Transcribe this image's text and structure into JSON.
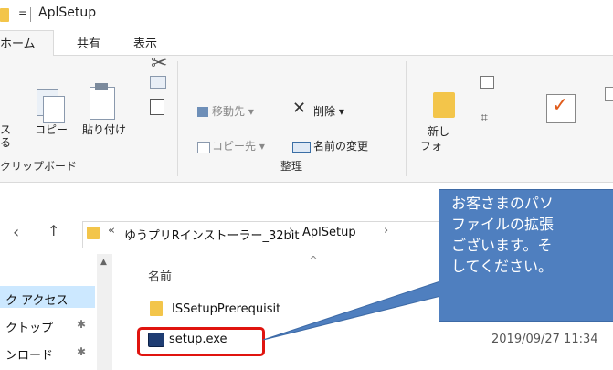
{
  "window": {
    "title": "AplSetup",
    "quick_access_dropdown": "="
  },
  "tabs": [
    {
      "label": "ホーム",
      "active": true
    },
    {
      "label": "共有",
      "active": false
    },
    {
      "label": "表示",
      "active": false
    }
  ],
  "ribbon": {
    "clipboard": {
      "pin_label": "ス",
      "pin_label_2": "る",
      "copy_label": "コピー",
      "paste_label": "貼り付け",
      "group_label": "クリップボード"
    },
    "organize": {
      "move_to": "移動先",
      "delete": "削除",
      "copy_to": "コピー先",
      "rename": "名前の変更",
      "group_label": "整理"
    },
    "new": {
      "label_1": "新し",
      "label_2": "フォ"
    }
  },
  "address": {
    "overflow": "«",
    "segments": [
      "ゆうプリRインストーラー_32bit",
      "AplSetup"
    ]
  },
  "nav": {
    "items": [
      {
        "label": "ク アクセス",
        "pinned": false
      },
      {
        "label": "クトップ",
        "pinned": true
      },
      {
        "label": "ンロード",
        "pinned": true
      }
    ]
  },
  "file_list": {
    "column_name": "名前",
    "files": [
      {
        "name": "ISSetupPrerequisit",
        "date": ""
      },
      {
        "name": "setup.exe",
        "date": "2019/09/27 11:34"
      }
    ]
  },
  "callout": {
    "text": "お客さまのパソ\nファイルの拡張\nございます。そ\nしてください。"
  },
  "colors": {
    "accent": "#4f7fbf",
    "highlight": "#e0140f",
    "selection": "#cce8ff"
  }
}
